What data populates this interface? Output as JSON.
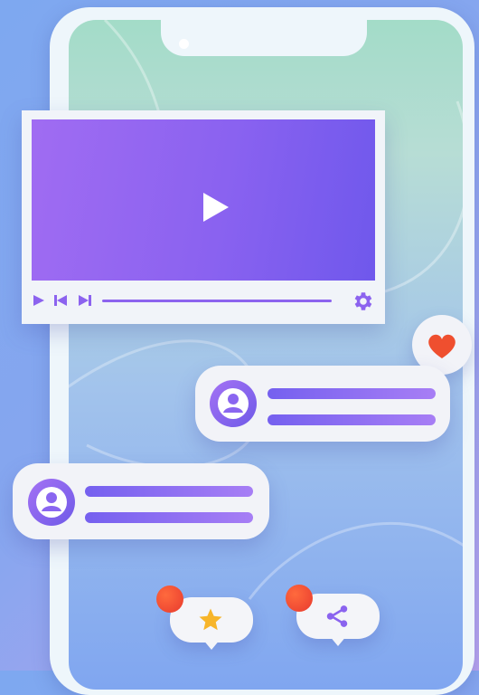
{
  "scene": {
    "background_colors": [
      "#7ea8f0",
      "#b9a3ee"
    ],
    "screen_colors": [
      "#a3dcc8",
      "#80a6f0"
    ]
  },
  "video_player": {
    "accent": "#8c63ef",
    "video_gradient": [
      "#a06cf2",
      "#6f58ec"
    ],
    "controls": [
      "play-icon",
      "skip-back-icon",
      "skip-forward-icon",
      "gear-icon"
    ]
  },
  "comments": [
    {
      "avatar": "user-icon",
      "lines": 2
    },
    {
      "avatar": "user-icon",
      "lines": 2
    }
  ],
  "reactions": {
    "heart": {
      "icon": "heart-icon",
      "color": "#ef4f2f"
    },
    "favorite": {
      "icon": "star-icon",
      "color": "#f7b52a",
      "notification": true
    },
    "share": {
      "icon": "share-icon",
      "color": "#8a63ef",
      "notification": true
    }
  }
}
